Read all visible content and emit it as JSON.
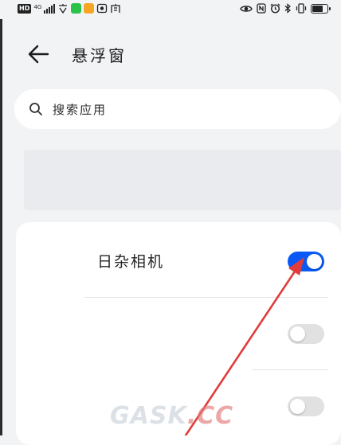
{
  "status_bar": {
    "left_text": "HD",
    "network": "4G",
    "right_icons": [
      "eye-icon",
      "nfc-icon",
      "alarm-icon",
      "bluetooth-icon",
      "vibrate-icon",
      "battery-icon"
    ]
  },
  "header": {
    "back_icon": "arrow-left-icon",
    "title": "悬浮窗"
  },
  "search": {
    "placeholder": "搜索应用",
    "icon": "search-icon"
  },
  "apps": [
    {
      "label": "日杂相机",
      "enabled": true
    },
    {
      "label": "",
      "enabled": false
    },
    {
      "label": "",
      "enabled": false
    }
  ],
  "watermark": {
    "main": "GASK",
    "accent": ".CC"
  },
  "colors": {
    "background": "#f1f3f5",
    "toggle_on": "#0a59f7",
    "toggle_off": "#e1e1e1",
    "annotation_arrow": "#e03c3c"
  }
}
